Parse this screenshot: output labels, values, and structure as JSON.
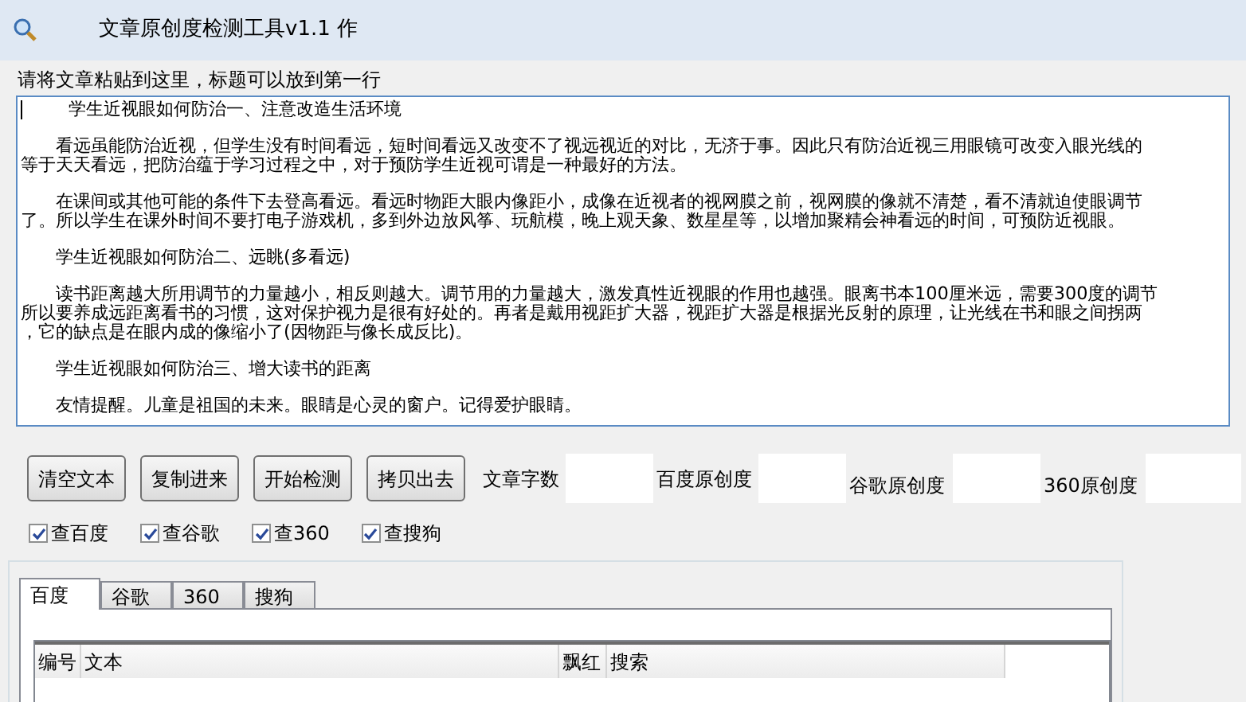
{
  "window": {
    "title": "文章原创度检测工具v1.1 作"
  },
  "article": {
    "label": "请将文章粘贴到这里，标题可以放到第一行",
    "paragraphs": [
      {
        "lines": [
          "学生近视眼如何防治一、注意改造生活环境"
        ]
      },
      {
        "lines": [
          "看远虽能防治近视，但学生没有时间看远，短时间看远又改变不了视远视近的对比，无济于事。因此只有防治近视三用眼镜可改变入眼光线的",
          "等于天天看远，把防治蕴于学习过程之中，对于预防学生近视可谓是一种最好的方法。"
        ]
      },
      {
        "lines": [
          "在课间或其他可能的条件下去登高看远。看远时物距大眼内像距小，成像在近视者的视网膜之前，视网膜的像就不清楚，看不清就迫使眼调节",
          "了。所以学生在课外时间不要打电子游戏机，多到外边放风筝、玩航模，晚上观天象、数星星等，以增加聚精会神看远的时间，可预防近视眼。"
        ]
      },
      {
        "lines": [
          "学生近视眼如何防治二、远眺(多看远)"
        ]
      },
      {
        "lines": [
          "读书距离越大所用调节的力量越小，相反则越大。调节用的力量越大，激发真性近视眼的作用也越强。眼离书本100厘米远，需要300度的调节",
          "所以要养成远距离看书的习惯，这对保护视力是很有好处的。再者是戴用视距扩大器，视距扩大器是根据光反射的原理，让光线在书和眼之间拐两",
          "，它的缺点是在眼内成的像缩小了(因物距与像长成反比)。"
        ]
      },
      {
        "lines": [
          "学生近视眼如何防治三、增大读书的距离"
        ]
      },
      {
        "lines": [
          "友情提醒。儿童是祖国的未来。眼睛是心灵的窗户。记得爱护眼睛。"
        ]
      }
    ]
  },
  "buttons": [
    "清空文本",
    "复制进来",
    "开始检测",
    "拷贝出去"
  ],
  "fields": [
    {
      "label": "文章字数"
    },
    {
      "label": "百度原创度"
    },
    {
      "label": "谷歌原创度"
    },
    {
      "label": "360原创度"
    }
  ],
  "checkboxes": [
    {
      "label": "查百度",
      "checked": true
    },
    {
      "label": "查谷歌",
      "checked": true
    },
    {
      "label": "查360",
      "checked": true
    },
    {
      "label": "查搜狗",
      "checked": true
    }
  ],
  "tabs": [
    {
      "label": "百度",
      "selected": true
    },
    {
      "label": "谷歌",
      "selected": false
    },
    {
      "label": "360",
      "selected": false
    },
    {
      "label": "搜狗",
      "selected": false
    }
  ],
  "table": {
    "columns": [
      "编号",
      "文本",
      "飘红",
      "搜索"
    ]
  }
}
